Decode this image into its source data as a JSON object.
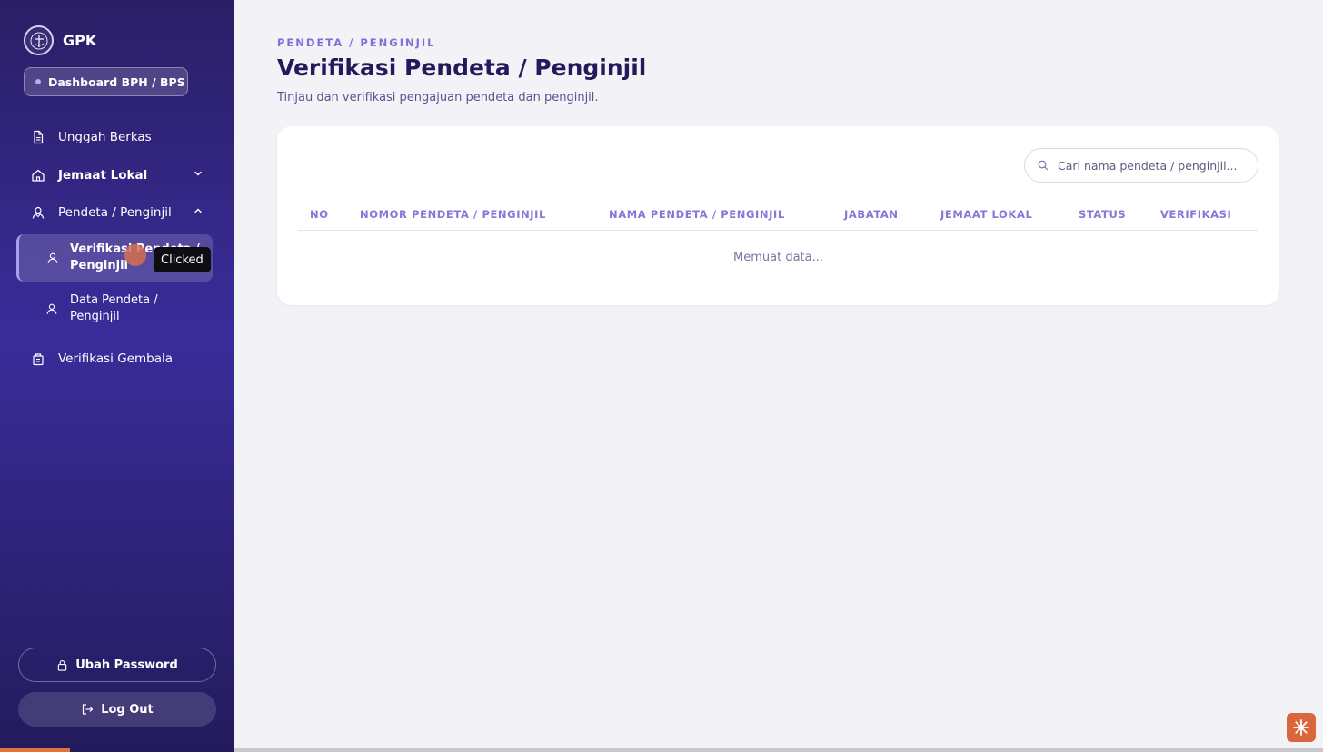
{
  "sidebar": {
    "brand": "GPK",
    "role_badge": "Dashboard BPH / BPS",
    "items": [
      {
        "label": "Unggah Berkas"
      },
      {
        "label": "Jemaat Lokal"
      },
      {
        "label": "Pendeta / Penginjil"
      },
      {
        "label": "Verifikasi Gembala"
      }
    ],
    "sub_items": [
      {
        "line1": "Verifikasi Pendeta /",
        "line2": "Penginjil"
      },
      {
        "line1": "Data Pendeta /",
        "line2": "Penginjil"
      }
    ],
    "change_password": "Ubah Password",
    "logout": "Log Out",
    "tooltip": "Clicked"
  },
  "main": {
    "eyebrow": "PENDETA / PENGINJIL",
    "title": "Verifikasi Pendeta / Penginjil",
    "subtitle": "Tinjau dan verifikasi pengajuan pendeta dan penginjil.",
    "search_placeholder": "Cari nama pendeta / penginjil...",
    "columns": [
      "NO",
      "NOMOR PENDETA / PENGINJIL",
      "NAMA PENDETA / PENGINJIL",
      "JABATAN",
      "JEMAAT LOKAL",
      "STATUS",
      "VERIFIKASI"
    ],
    "loading_text": "Memuat data..."
  },
  "colors": {
    "accent": "#7e70d6",
    "title": "#221a5a",
    "sidebar_top": "#2a1f66",
    "sidebar_mid": "#3a2c9a",
    "corner_button": "#d9663c"
  }
}
